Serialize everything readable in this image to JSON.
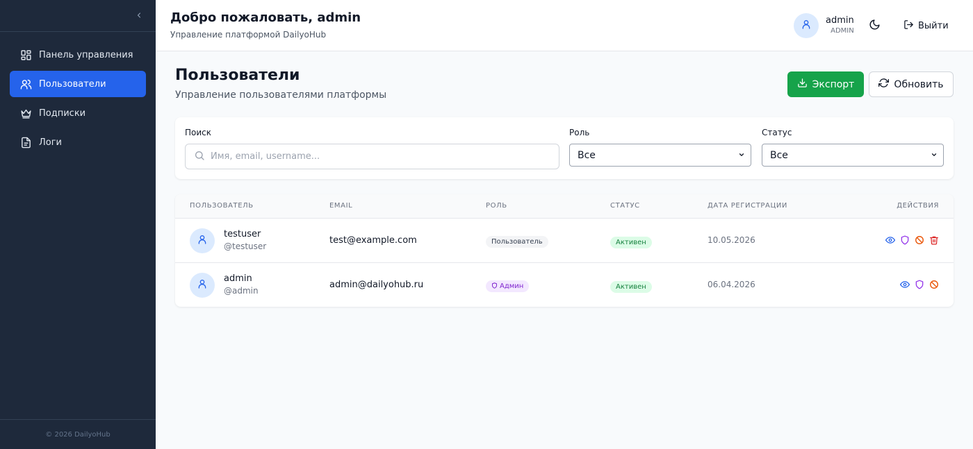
{
  "sidebar": {
    "items": [
      {
        "label": "Панель управления",
        "icon": "dashboard-icon"
      },
      {
        "label": "Пользователи",
        "icon": "users-icon",
        "active": true
      },
      {
        "label": "Подписки",
        "icon": "crown-icon"
      },
      {
        "label": "Логи",
        "icon": "file-text-icon"
      }
    ],
    "footer": "© 2026 DailyoHub"
  },
  "header": {
    "title": "Добро пожаловать, admin",
    "subtitle": "Управление платформой DailyoHub",
    "user_name": "admin",
    "user_role": "ADMIN",
    "logout_label": "Выйти"
  },
  "page": {
    "title": "Пользователи",
    "subtitle": "Управление пользователями платформы",
    "export_label": "Экспорт",
    "refresh_label": "Обновить"
  },
  "filters": {
    "search_label": "Поиск",
    "search_placeholder": "Имя, email, username...",
    "search_value": "",
    "role_label": "Роль",
    "role_value": "Все",
    "status_label": "Статус",
    "status_value": "Все"
  },
  "table": {
    "headers": {
      "user": "ПОЛЬЗОВАТЕЛЬ",
      "email": "EMAIL",
      "role": "РОЛЬ",
      "status": "СТАТУС",
      "date": "ДАТА РЕГИСТРАЦИИ",
      "actions": "ДЕЙСТВИЯ"
    },
    "rows": [
      {
        "name": "testuser",
        "handle": "@testuser",
        "email": "test@example.com",
        "role": "Пользователь",
        "status": "Активен",
        "date": "10.05.2026"
      },
      {
        "name": "admin",
        "handle": "@admin",
        "email": "admin@dailyohub.ru",
        "role": "Админ",
        "status": "Активен",
        "date": "06.04.2026"
      }
    ]
  },
  "colors": {
    "sidebar_bg": "#1e293b",
    "accent": "#2563eb",
    "export_green": "#16a34a",
    "active_status": "#15803d",
    "admin_badge": "#7e22ce"
  }
}
